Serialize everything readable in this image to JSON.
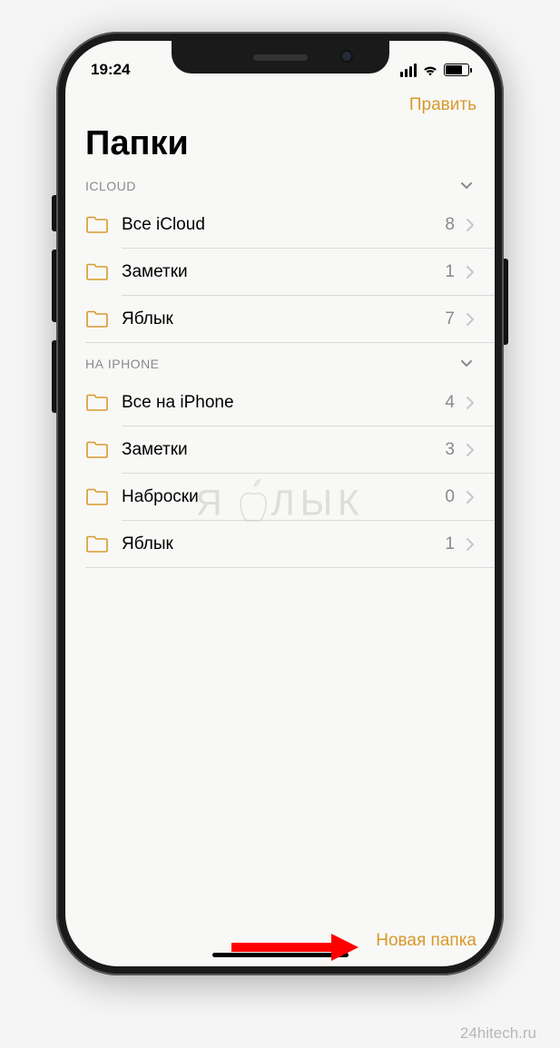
{
  "status": {
    "time": "19:24"
  },
  "nav": {
    "edit_label": "Править"
  },
  "title": "Папки",
  "sections": [
    {
      "header": "ICLOUD",
      "rows": [
        {
          "label": "Все iCloud",
          "count": "8"
        },
        {
          "label": "Заметки",
          "count": "1"
        },
        {
          "label": "Яблык",
          "count": "7"
        }
      ]
    },
    {
      "header": "НА IPHONE",
      "rows": [
        {
          "label": "Все на iPhone",
          "count": "4"
        },
        {
          "label": "Заметки",
          "count": "3"
        },
        {
          "label": "Наброски",
          "count": "0"
        },
        {
          "label": "Яблык",
          "count": "1"
        }
      ]
    }
  ],
  "toolbar": {
    "new_folder_label": "Новая папка"
  },
  "watermark": "ЯБЛЫК",
  "source_caption": "24hitech.ru"
}
